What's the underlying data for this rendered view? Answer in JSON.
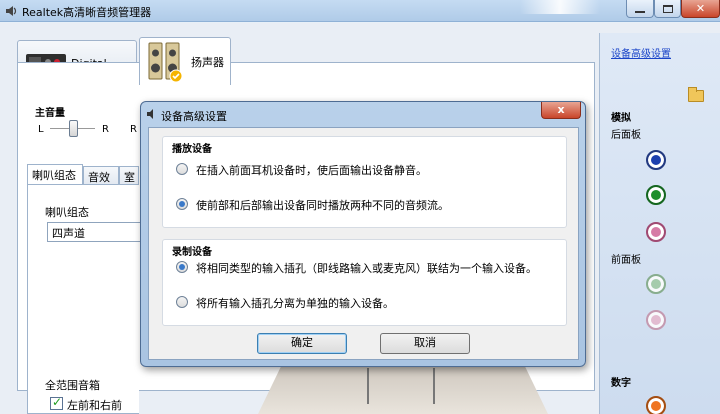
{
  "window": {
    "title": "Realtek高清晰音频管理器"
  },
  "device_tabs": [
    {
      "label": "Digital Output"
    },
    {
      "label": "扬声器"
    }
  ],
  "volume": {
    "label": "主音量",
    "left": "L",
    "right": "R",
    "extra": "R"
  },
  "inner_tabs": [
    {
      "label": "喇叭组态"
    },
    {
      "label": "音效"
    },
    {
      "label": "室"
    }
  ],
  "speaker_config": {
    "label": "喇叭组态",
    "selected": "四声道"
  },
  "full_range": {
    "label": "全范围音箱",
    "front_lr": "左前和右前",
    "front_lr_checked": true
  },
  "right_panel": {
    "advanced_link": "设备高级设置",
    "analog": "模拟",
    "rear_panel": "后面板",
    "front_panel": "前面板",
    "digital": "数字"
  },
  "dialog": {
    "title": "设备高级设置",
    "close": "x",
    "playback": {
      "title": "播放设备",
      "options": [
        {
          "label": "在插入前面耳机设备时，使后面输出设备静音。",
          "selected": false
        },
        {
          "label": "使前部和后部输出设备同时播放两种不同的音频流。",
          "selected": true
        }
      ]
    },
    "recording": {
      "title": "录制设备",
      "options": [
        {
          "label": "将相同类型的输入插孔（即线路输入或麦克风）联结为一个输入设备。",
          "selected": true
        },
        {
          "label": "将所有输入插孔分离为单独的输入设备。",
          "selected": false
        }
      ]
    },
    "ok": "确定",
    "cancel": "取消"
  },
  "colors": {
    "jack_blue": "#1c3fae",
    "jack_green": "#1d8f2b",
    "jack_pink": "#d67ba6",
    "jack_orange": "#ef7420",
    "link": "#1a44c8"
  }
}
